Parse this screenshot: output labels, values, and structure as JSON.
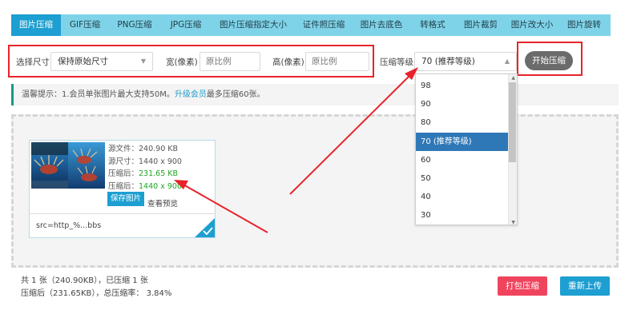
{
  "tabs": [
    "图片压缩",
    "GIF压缩",
    "PNG压缩",
    "JPG压缩",
    "图片压缩指定大小",
    "证件照压缩",
    "图片去底色",
    "转格式",
    "图片裁剪",
    "图片改大小",
    "图片旋转"
  ],
  "settings": {
    "size_label": "选择尺寸",
    "size_value": "保持原始尺寸",
    "width_label": "宽(像素)",
    "width_placeholder": "原比例",
    "height_label": "高(像素)",
    "height_placeholder": "原比例",
    "level_label": "压缩等级",
    "level_value": "70 (推荐等级)",
    "start_button": "开始压缩"
  },
  "tip": {
    "prefix": "温馨提示：1.会员单张图片最大支持50M。",
    "link": "升级会员",
    "suffix": "最多压缩60张。"
  },
  "dropdown": {
    "options": [
      "98",
      "90",
      "80",
      "70 (推荐等级)",
      "60",
      "50",
      "40",
      "30"
    ],
    "selected_index": 3
  },
  "card": {
    "source_file": "源文件：240.90 KB",
    "source_size": "源尺寸：1440 x 900",
    "compressed_label": "压缩后：",
    "compressed_file": "231.65 KB",
    "compressed_dims_label": "压缩后：",
    "compressed_dims": "1440 x 900",
    "save_button": "保存图片",
    "preview_link": "查看预览",
    "src_text": "src=http_%...bbs"
  },
  "footer": {
    "line1": "共 1 张（240.90KB），已压缩 1 张",
    "line2": "压缩后（231.65KB），总压缩率： 3.84%",
    "pack_button": "打包压缩",
    "reupload_button": "重新上传"
  },
  "colors": {
    "tab_bar": "#7fd3e8",
    "tab_active": "#1d9fd1",
    "annotation_red": "#e8232b",
    "dropdown_selected": "#2f78b7",
    "pack_button": "#f0445e",
    "compressed_text": "#1ea824"
  }
}
